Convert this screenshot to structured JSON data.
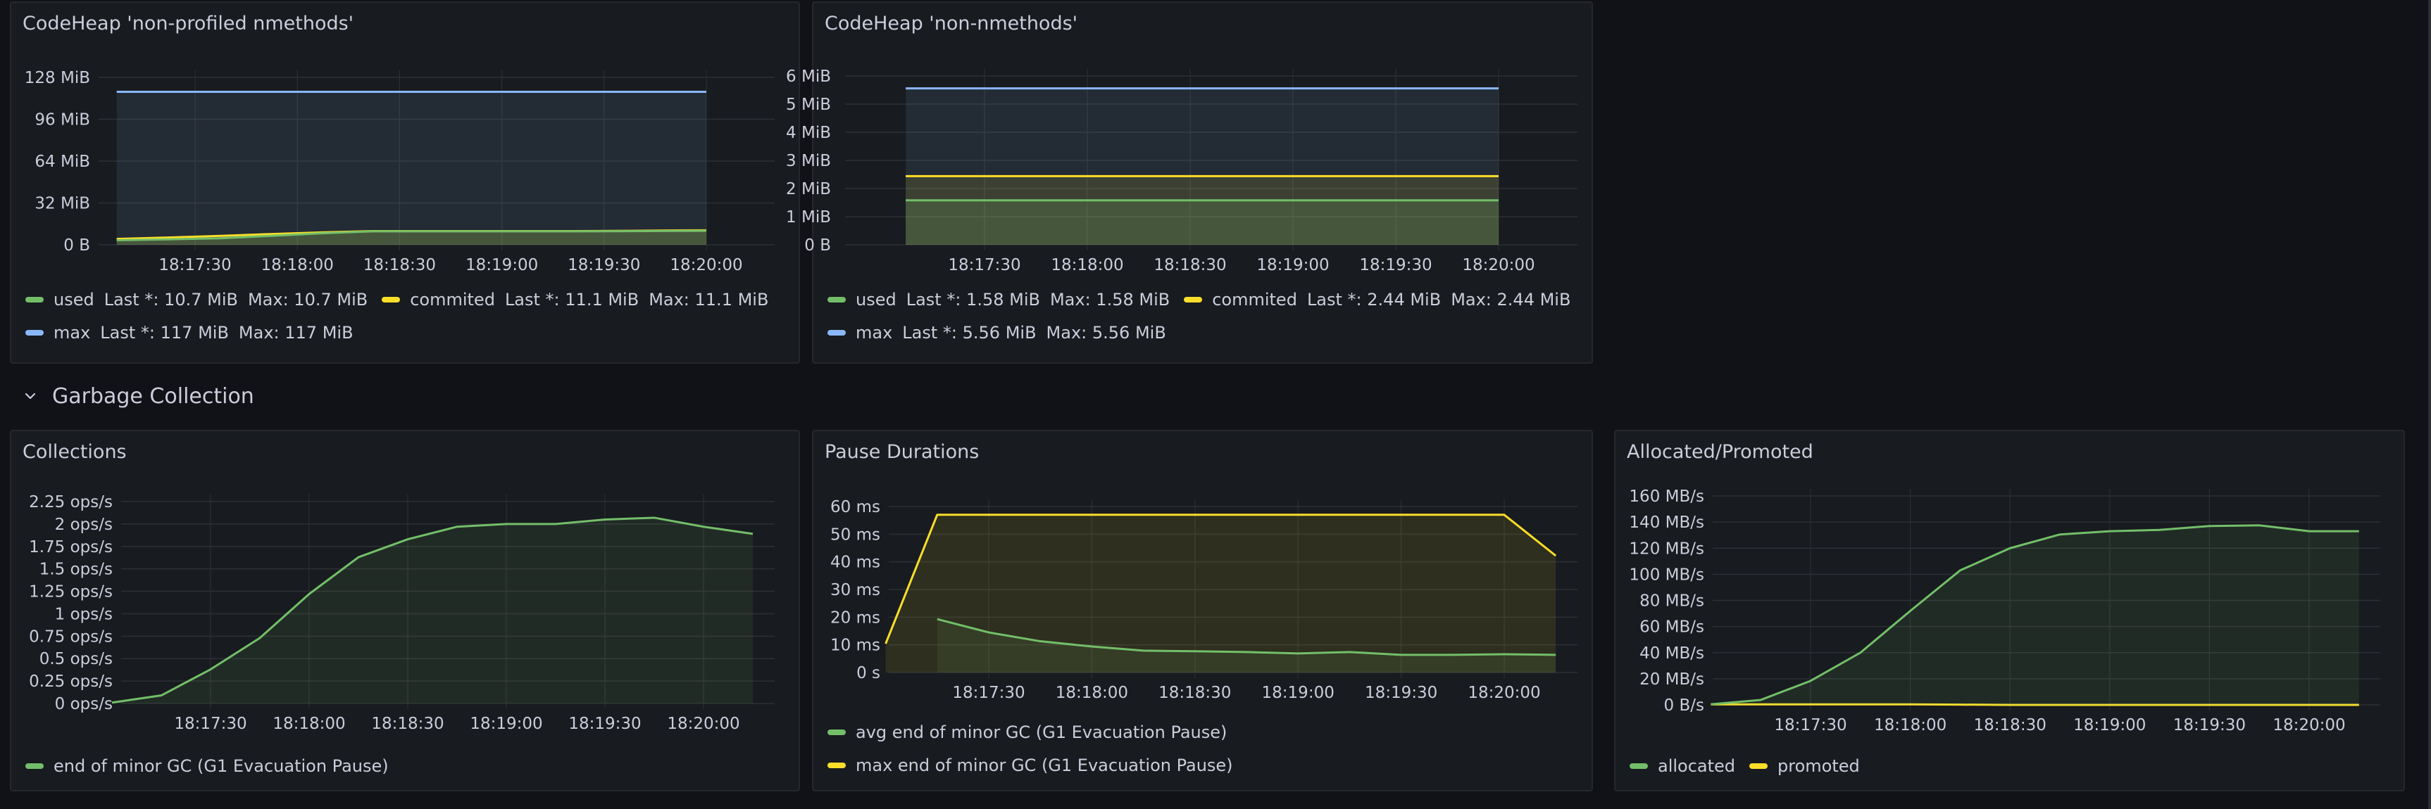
{
  "dashboard": {
    "row": {
      "title": "Garbage Collection",
      "collapsed": false,
      "chevron_icon": "chevron-down-icon"
    }
  },
  "colors": {
    "green": "#73bf69",
    "yellow": "#fade2a",
    "blue": "#8ab8ff",
    "grid": "#2c2f35",
    "text": "#ccccdc"
  },
  "x_ticks": [
    "18:17:30",
    "18:18:00",
    "18:18:30",
    "18:19:00",
    "18:19:30",
    "18:20:00"
  ],
  "panels": [
    {
      "title": "CodeHeap 'non-profiled nmethods'",
      "legend": [
        {
          "name": "used",
          "color": "#73bf69",
          "last": "Last *: 10.7 MiB",
          "max": "Max: 10.7 MiB"
        },
        {
          "name": "commited",
          "color": "#fade2a",
          "last": "Last *: 11.1 MiB",
          "max": "Max: 11.1 MiB"
        },
        {
          "name": "max",
          "color": "#8ab8ff",
          "last": "Last *: 117 MiB",
          "max": "Max: 117 MiB"
        }
      ]
    },
    {
      "title": "CodeHeap 'non-nmethods'",
      "legend": [
        {
          "name": "used",
          "color": "#73bf69",
          "last": "Last *: 1.58 MiB",
          "max": "Max: 1.58 MiB"
        },
        {
          "name": "commited",
          "color": "#fade2a",
          "last": "Last *: 2.44 MiB",
          "max": "Max: 2.44 MiB"
        },
        {
          "name": "max",
          "color": "#8ab8ff",
          "last": "Last *: 5.56 MiB",
          "max": "Max: 5.56 MiB"
        }
      ]
    },
    {
      "title": "Collections",
      "legend": [
        {
          "name": "end of minor GC (G1 Evacuation Pause)",
          "color": "#73bf69"
        }
      ]
    },
    {
      "title": "Pause Durations",
      "legend": [
        {
          "name": "avg end of minor GC (G1 Evacuation Pause)",
          "color": "#73bf69"
        },
        {
          "name": "max end of minor GC (G1 Evacuation Pause)",
          "color": "#fade2a"
        }
      ]
    },
    {
      "title": "Allocated/Promoted",
      "legend": [
        {
          "name": "allocated",
          "color": "#73bf69"
        },
        {
          "name": "promoted",
          "color": "#fade2a"
        }
      ]
    }
  ],
  "chart_data": [
    {
      "type": "area",
      "title": "CodeHeap 'non-profiled nmethods'",
      "xlabel": "",
      "ylabel": "",
      "x_unit": "time (seconds after 18:17:00)",
      "xlim": [
        "18:17:00",
        "18:20:30"
      ],
      "x_tick_labels": [
        "18:17:30",
        "18:18:00",
        "18:18:30",
        "18:19:00",
        "18:19:30",
        "18:20:00"
      ],
      "y_ticks": [
        0,
        32,
        64,
        96,
        128
      ],
      "y_tick_labels": [
        "0 B",
        "32 MiB",
        "64 MiB",
        "96 MiB",
        "128 MiB"
      ],
      "ylim": [
        0,
        128
      ],
      "y_unit": "MiB",
      "grid": true,
      "legend_position": "bottom",
      "x": [
        7,
        22,
        37,
        52,
        67,
        82,
        97,
        112,
        127,
        142,
        157,
        172,
        180
      ],
      "series": [
        {
          "name": "used",
          "color": "#73bf69",
          "values": [
            3.5,
            4.2,
            5.0,
            6.8,
            8.8,
            10.3,
            10.3,
            10.3,
            10.3,
            10.3,
            10.4,
            10.6,
            10.7
          ]
        },
        {
          "name": "commited",
          "color": "#fade2a",
          "values": [
            4.5,
            5.6,
            6.8,
            8.2,
            9.5,
            10.5,
            10.5,
            10.5,
            10.5,
            10.5,
            10.7,
            11.0,
            11.1
          ]
        },
        {
          "name": "max",
          "color": "#8ab8ff",
          "values": [
            117,
            117,
            117,
            117,
            117,
            117,
            117,
            117,
            117,
            117,
            117,
            117,
            117
          ]
        }
      ]
    },
    {
      "type": "area",
      "title": "CodeHeap 'non-nmethods'",
      "xlabel": "",
      "ylabel": "",
      "x_unit": "time (seconds after 18:17:00)",
      "xlim": [
        "18:17:00",
        "18:20:30"
      ],
      "x_tick_labels": [
        "18:17:30",
        "18:18:00",
        "18:18:30",
        "18:19:00",
        "18:19:30",
        "18:20:00"
      ],
      "y_ticks": [
        0,
        1,
        2,
        3,
        4,
        5,
        6
      ],
      "y_tick_labels": [
        "0 B",
        "1 MiB",
        "2 MiB",
        "3 MiB",
        "4 MiB",
        "5 MiB",
        "6 MiB"
      ],
      "ylim": [
        0,
        6
      ],
      "y_unit": "MiB",
      "grid": true,
      "legend_position": "bottom",
      "x": [
        7,
        180
      ],
      "series": [
        {
          "name": "used",
          "color": "#73bf69",
          "values": [
            1.58,
            1.58
          ]
        },
        {
          "name": "commited",
          "color": "#fade2a",
          "values": [
            2.44,
            2.44
          ]
        },
        {
          "name": "max",
          "color": "#8ab8ff",
          "values": [
            5.56,
            5.56
          ]
        }
      ]
    },
    {
      "type": "area",
      "title": "Collections",
      "xlabel": "",
      "ylabel": "",
      "x_unit": "time (seconds after 18:17:00)",
      "xlim": [
        "18:17:00",
        "18:20:25"
      ],
      "x_tick_labels": [
        "18:17:30",
        "18:18:00",
        "18:18:30",
        "18:19:00",
        "18:19:30",
        "18:20:00"
      ],
      "y_ticks": [
        0,
        0.25,
        0.5,
        0.75,
        1,
        1.25,
        1.5,
        1.75,
        2,
        2.25
      ],
      "y_tick_labels": [
        "0 ops/s",
        "0.25 ops/s",
        "0.5 ops/s",
        "0.75 ops/s",
        "1 ops/s",
        "1.25 ops/s",
        "1.5 ops/s",
        "1.75 ops/s",
        "2 ops/s",
        "2.25 ops/s"
      ],
      "ylim": [
        0,
        2.25
      ],
      "y_unit": "ops/s",
      "grid": true,
      "legend_position": "bottom",
      "x": [
        0,
        15,
        30,
        45,
        60,
        75,
        90,
        105,
        120,
        135,
        150,
        165,
        180,
        195
      ],
      "series": [
        {
          "name": "end of minor GC (G1 Evacuation Pause)",
          "color": "#73bf69",
          "values": [
            0.01,
            0.09,
            0.38,
            0.73,
            1.22,
            1.63,
            1.83,
            1.97,
            2.0,
            2.0,
            2.05,
            2.07,
            1.97,
            1.89
          ]
        }
      ]
    },
    {
      "type": "area",
      "title": "Pause Durations",
      "xlabel": "",
      "ylabel": "",
      "x_unit": "time (seconds after 18:17:00)",
      "xlim": [
        "18:17:00",
        "18:20:25"
      ],
      "x_tick_labels": [
        "18:17:30",
        "18:18:00",
        "18:18:30",
        "18:19:00",
        "18:19:30",
        "18:20:00"
      ],
      "y_ticks": [
        0,
        10,
        20,
        30,
        40,
        50,
        60
      ],
      "y_tick_labels": [
        "0 s",
        "10 ms",
        "20 ms",
        "30 ms",
        "40 ms",
        "50 ms",
        "60 ms"
      ],
      "ylim": [
        0,
        60
      ],
      "y_unit": "ms",
      "grid": true,
      "legend_position": "bottom",
      "series": [
        {
          "name": "avg end of minor GC (G1 Evacuation Pause)",
          "color": "#73bf69",
          "x": [
            15,
            30,
            45,
            60,
            75,
            90,
            105,
            120,
            135,
            150,
            165,
            180,
            195
          ],
          "values": [
            19.3,
            14.5,
            11.3,
            9.4,
            7.9,
            7.7,
            7.4,
            6.9,
            7.4,
            6.4,
            6.4,
            6.6,
            6.4
          ]
        },
        {
          "name": "max end of minor GC (G1 Evacuation Pause)",
          "color": "#fade2a",
          "x": [
            0,
            15,
            30,
            45,
            60,
            75,
            90,
            105,
            120,
            135,
            150,
            165,
            180,
            195
          ],
          "values": [
            10.4,
            57,
            57,
            57,
            57,
            57,
            57,
            57,
            57,
            57,
            57,
            57,
            57,
            42.2
          ]
        }
      ]
    },
    {
      "type": "area",
      "title": "Allocated/Promoted",
      "xlabel": "",
      "ylabel": "",
      "x_unit": "time (seconds after 18:17:00)",
      "xlim": [
        "18:17:00",
        "18:20:25"
      ],
      "x_tick_labels": [
        "18:17:30",
        "18:18:00",
        "18:18:30",
        "18:19:00",
        "18:19:30",
        "18:20:00"
      ],
      "y_ticks": [
        0,
        20,
        40,
        60,
        80,
        100,
        120,
        140,
        160
      ],
      "y_tick_labels": [
        "0 B/s",
        "20 MB/s",
        "40 MB/s",
        "60 MB/s",
        "80 MB/s",
        "100 MB/s",
        "120 MB/s",
        "140 MB/s",
        "160 MB/s"
      ],
      "ylim": [
        0,
        160
      ],
      "y_unit": "MB/s",
      "grid": true,
      "legend_position": "bottom",
      "x": [
        0,
        15,
        30,
        45,
        60,
        75,
        90,
        105,
        120,
        135,
        150,
        165,
        180,
        195
      ],
      "series": [
        {
          "name": "allocated",
          "color": "#73bf69",
          "values": [
            0.5,
            3.8,
            18.4,
            40,
            72,
            103,
            120,
            130.5,
            133,
            134,
            137,
            137.5,
            133,
            133
          ]
        },
        {
          "name": "promoted",
          "color": "#fade2a",
          "values": [
            0.4,
            0.4,
            0.4,
            0.4,
            0.4,
            0.2,
            0,
            0,
            0,
            0,
            0,
            0,
            0,
            0
          ]
        }
      ]
    }
  ]
}
